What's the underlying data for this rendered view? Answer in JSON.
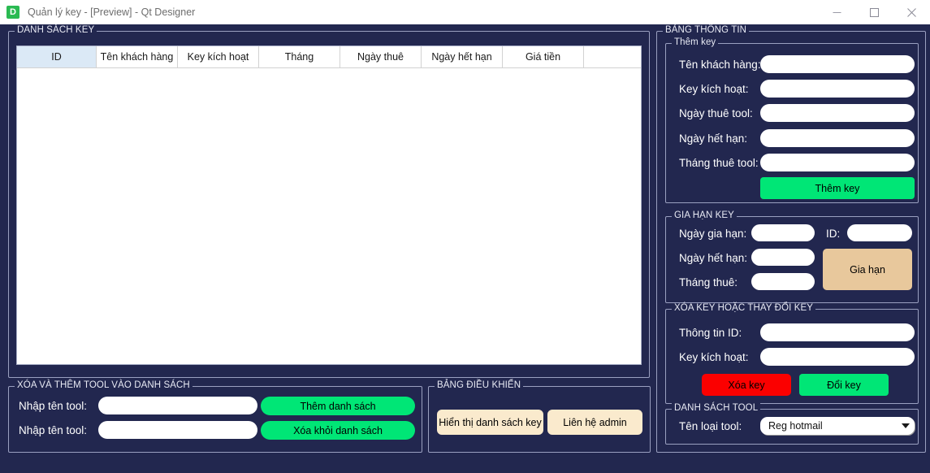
{
  "window": {
    "title": "Quản lý key - [Preview] - Qt Designer",
    "icon_letter": "D",
    "icon_name": "qt-designer-icon",
    "minimize_label": "Minimize",
    "maximize_label": "Maximize",
    "close_label": "Close",
    "background_color": "#22274f"
  },
  "key_list_group": {
    "legend": "DANH SÁCH KEY",
    "columns": [
      "ID",
      "Tên khách hàng",
      "Key kích hoạt",
      "Tháng",
      "Ngày thuê",
      "Ngày hết hạn",
      "Giá tiền",
      ""
    ],
    "selected_column_index": 0,
    "rows": []
  },
  "tool_list_group": {
    "legend": "XÓA VÀ THÊM TOOL VÀO DANH SÁCH",
    "add_label": "Nhập tên tool:",
    "add_value": "",
    "add_button": "Thêm danh sách",
    "remove_label": "Nhập tên tool:",
    "remove_value": "",
    "remove_button": "Xóa khỏi danh sách"
  },
  "control_group": {
    "legend": "BẢNG ĐIỀU KHIỂN",
    "show_list_button": "Hiển thị danh sách key",
    "contact_admin_button": "Liên hệ admin"
  },
  "info_group": {
    "legend": "BẢNG THÔNG TIN",
    "add_key": {
      "legend": "Thêm key",
      "customer_name_label": "Tên khách hàng:",
      "customer_name_value": "",
      "activation_key_label": "Key kích hoạt:",
      "activation_key_value": "",
      "rent_date_label": "Ngày thuê tool:",
      "rent_date_value": "",
      "expiry_date_label": "Ngày hết hạn:",
      "expiry_date_value": "",
      "months_label": "Tháng thuê tool:",
      "months_value": "",
      "submit_button": "Thêm key"
    },
    "renew_key": {
      "legend": "GIA HẠN KEY",
      "renew_date_label": "Ngày gia hạn:",
      "renew_date_value": "",
      "id_label": "ID:",
      "id_value": "",
      "expiry_date_label": "Ngày hết hạn:",
      "expiry_date_value": "",
      "months_label": "Tháng thuê:",
      "months_value": "",
      "submit_button": "Gia hạn"
    },
    "delete_or_change_key": {
      "legend": "XÓA KEY HOẶC THAY ĐỔI KEY",
      "id_label": "Thông tin ID:",
      "id_value": "",
      "activation_key_label": "Key kích hoạt:",
      "activation_key_value": "",
      "delete_button": "Xóa key",
      "change_button": "Đổi key"
    },
    "tool_list": {
      "legend": "DANH SÁCH TOOL",
      "tool_type_label": "Tên loại tool:",
      "tool_type_value": "Reg hotmail"
    }
  },
  "colors": {
    "accent_green": "#00e676",
    "accent_red": "#fb0000",
    "accent_tan": "#e8c89c",
    "accent_cream": "#faeacd",
    "selected_header": "#dbe9f6"
  }
}
